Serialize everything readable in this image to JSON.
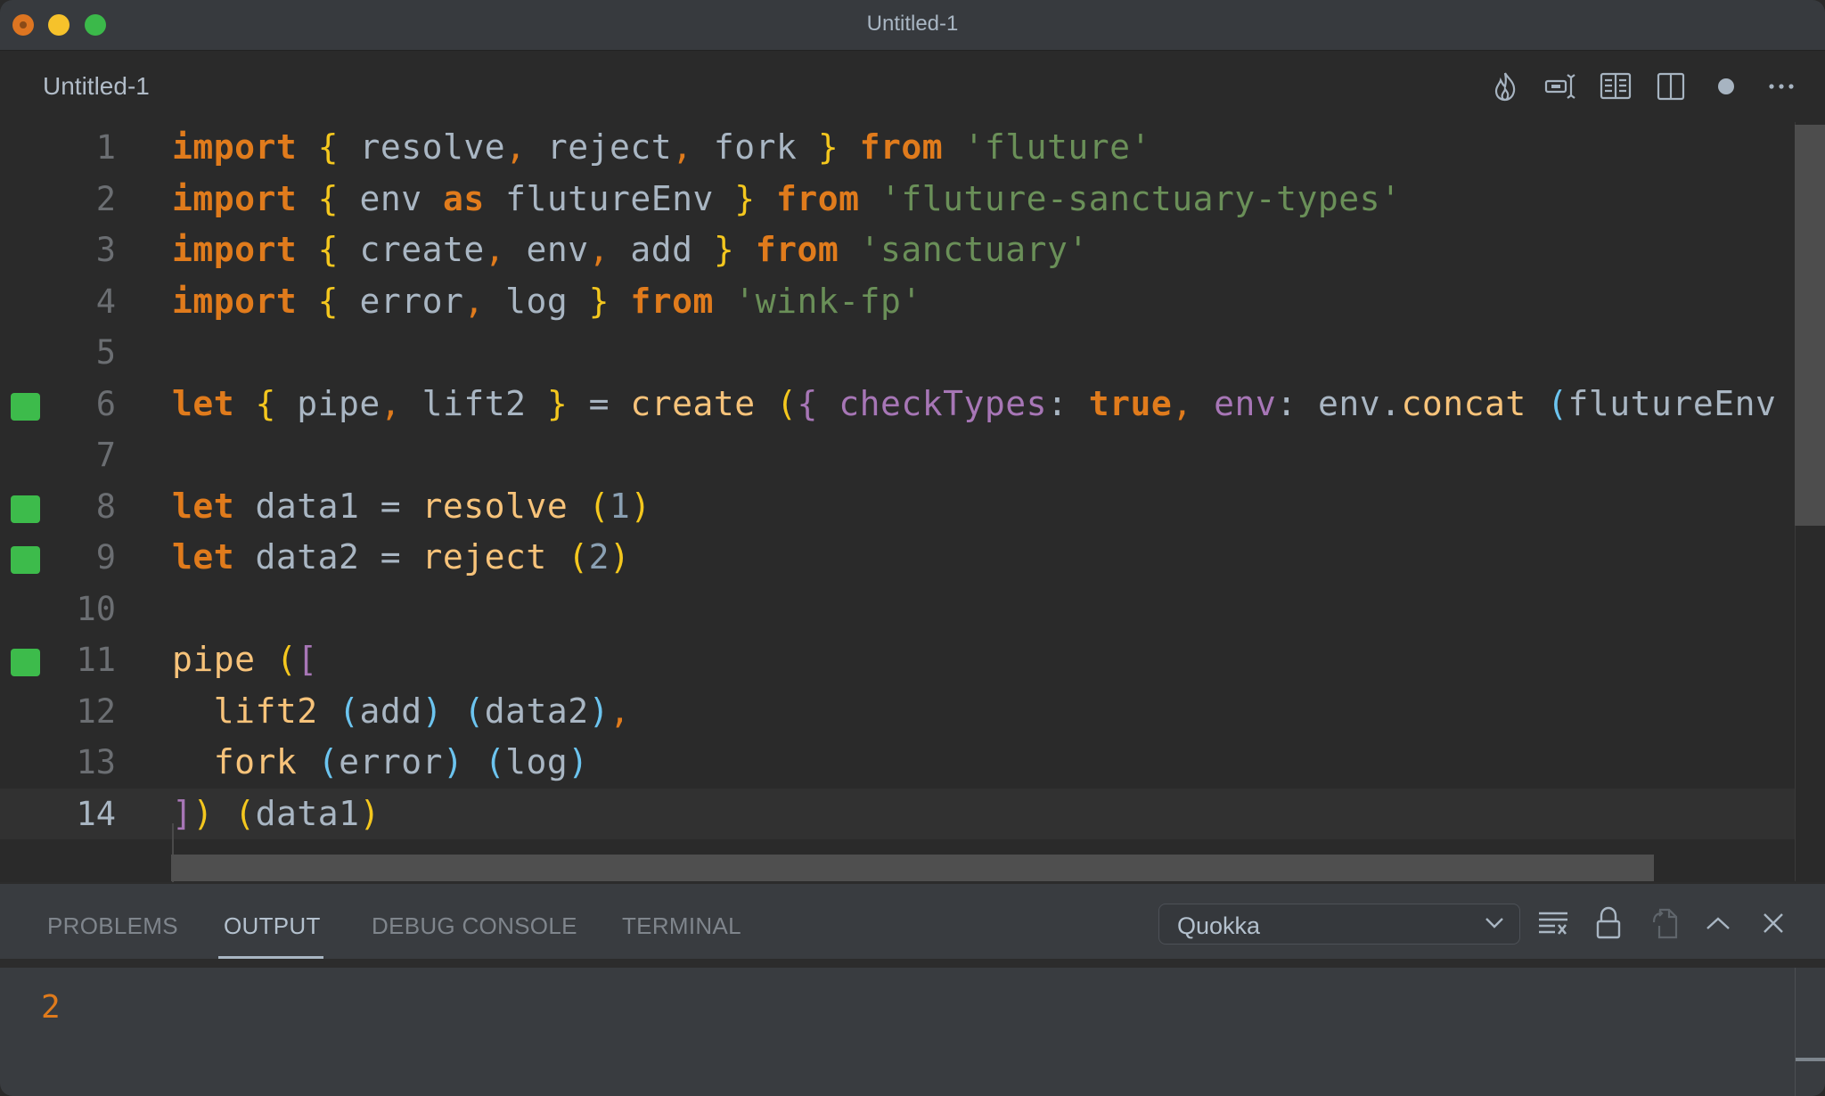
{
  "window": {
    "title": "Untitled-1"
  },
  "tab": {
    "label": "Untitled-1",
    "actions": [
      {
        "name": "quokka-flame-icon"
      },
      {
        "name": "toggle-value-icon"
      },
      {
        "name": "open-preview-icon"
      },
      {
        "name": "split-editor-icon"
      },
      {
        "name": "unsaved-dot-icon"
      },
      {
        "name": "more-actions-icon"
      }
    ]
  },
  "editor": {
    "current_line": 14,
    "lines": [
      {
        "number": "1",
        "marker": false
      },
      {
        "number": "2",
        "marker": false
      },
      {
        "number": "3",
        "marker": false
      },
      {
        "number": "4",
        "marker": false
      },
      {
        "number": "5",
        "marker": false
      },
      {
        "number": "6",
        "marker": true
      },
      {
        "number": "7",
        "marker": false
      },
      {
        "number": "8",
        "marker": true
      },
      {
        "number": "9",
        "marker": true
      },
      {
        "number": "10",
        "marker": false
      },
      {
        "number": "11",
        "marker": true
      },
      {
        "number": "12",
        "marker": false
      },
      {
        "number": "13",
        "marker": false
      },
      {
        "number": "14",
        "marker": false
      }
    ],
    "code": [
      [
        [
          "kw",
          "import"
        ],
        [
          "op",
          " "
        ],
        [
          "brace",
          "{"
        ],
        [
          "op",
          " resolve"
        ],
        [
          "punc",
          ","
        ],
        [
          "op",
          " reject"
        ],
        [
          "punc",
          ","
        ],
        [
          "op",
          " fork "
        ],
        [
          "brace",
          "}"
        ],
        [
          "op",
          " "
        ],
        [
          "kw",
          "from"
        ],
        [
          "op",
          " "
        ],
        [
          "str",
          "'fluture'"
        ]
      ],
      [
        [
          "kw",
          "import"
        ],
        [
          "op",
          " "
        ],
        [
          "brace",
          "{"
        ],
        [
          "op",
          " env "
        ],
        [
          "kw",
          "as"
        ],
        [
          "op",
          " flutureEnv "
        ],
        [
          "brace",
          "}"
        ],
        [
          "op",
          " "
        ],
        [
          "kw",
          "from"
        ],
        [
          "op",
          " "
        ],
        [
          "str",
          "'fluture-sanctuary-types'"
        ]
      ],
      [
        [
          "kw",
          "import"
        ],
        [
          "op",
          " "
        ],
        [
          "brace",
          "{"
        ],
        [
          "op",
          " create"
        ],
        [
          "punc",
          ","
        ],
        [
          "op",
          " env"
        ],
        [
          "punc",
          ","
        ],
        [
          "op",
          " add "
        ],
        [
          "brace",
          "}"
        ],
        [
          "op",
          " "
        ],
        [
          "kw",
          "from"
        ],
        [
          "op",
          " "
        ],
        [
          "str",
          "'sanctuary'"
        ]
      ],
      [
        [
          "kw",
          "import"
        ],
        [
          "op",
          " "
        ],
        [
          "brace",
          "{"
        ],
        [
          "op",
          " error"
        ],
        [
          "punc",
          ","
        ],
        [
          "op",
          " log "
        ],
        [
          "brace",
          "}"
        ],
        [
          "op",
          " "
        ],
        [
          "kw",
          "from"
        ],
        [
          "op",
          " "
        ],
        [
          "str",
          "'wink-fp'"
        ]
      ],
      [],
      [
        [
          "kw",
          "let"
        ],
        [
          "op",
          " "
        ],
        [
          "brace",
          "{"
        ],
        [
          "op",
          " pipe"
        ],
        [
          "punc",
          ","
        ],
        [
          "op",
          " lift2 "
        ],
        [
          "brace",
          "}"
        ],
        [
          "op",
          " = "
        ],
        [
          "fn",
          "create"
        ],
        [
          "op",
          " "
        ],
        [
          "brace",
          "("
        ],
        [
          "purple",
          "{"
        ],
        [
          "prop",
          " checkTypes"
        ],
        [
          "op",
          ": "
        ],
        [
          "bool",
          "true"
        ],
        [
          "punc",
          ","
        ],
        [
          "prop",
          " env"
        ],
        [
          "op",
          ": env."
        ],
        [
          "fn",
          "concat"
        ],
        [
          "op",
          " "
        ],
        [
          "blue",
          "("
        ],
        [
          "op",
          "flutureEnv"
        ]
      ],
      [],
      [
        [
          "kw",
          "let"
        ],
        [
          "op",
          " data1 = "
        ],
        [
          "fn",
          "resolve"
        ],
        [
          "op",
          " "
        ],
        [
          "brace",
          "("
        ],
        [
          "num",
          "1"
        ],
        [
          "brace",
          ")"
        ]
      ],
      [
        [
          "kw",
          "let"
        ],
        [
          "op",
          " data2 = "
        ],
        [
          "fn",
          "reject"
        ],
        [
          "op",
          " "
        ],
        [
          "brace",
          "("
        ],
        [
          "num",
          "2"
        ],
        [
          "brace",
          ")"
        ]
      ],
      [],
      [
        [
          "fn",
          "pipe"
        ],
        [
          "op",
          " "
        ],
        [
          "brace",
          "("
        ],
        [
          "purple",
          "["
        ]
      ],
      [
        [
          "op",
          "  "
        ],
        [
          "fn",
          "lift2"
        ],
        [
          "op",
          " "
        ],
        [
          "blue",
          "("
        ],
        [
          "op",
          "add"
        ],
        [
          "blue",
          ")"
        ],
        [
          "op",
          " "
        ],
        [
          "blue",
          "("
        ],
        [
          "op",
          "data2"
        ],
        [
          "blue",
          ")"
        ],
        [
          "punc",
          ","
        ]
      ],
      [
        [
          "op",
          "  "
        ],
        [
          "fn",
          "fork"
        ],
        [
          "op",
          " "
        ],
        [
          "blue",
          "("
        ],
        [
          "op",
          "error"
        ],
        [
          "blue",
          ")"
        ],
        [
          "op",
          " "
        ],
        [
          "blue",
          "("
        ],
        [
          "op",
          "log"
        ],
        [
          "blue",
          ")"
        ]
      ],
      [
        [
          "purple",
          "]"
        ],
        [
          "brace",
          ")"
        ],
        [
          "op",
          " "
        ],
        [
          "brace",
          "("
        ],
        [
          "op",
          "data1"
        ],
        [
          "brace",
          ")"
        ]
      ]
    ]
  },
  "panel": {
    "tabs": [
      {
        "label": "PROBLEMS",
        "active": false
      },
      {
        "label": "OUTPUT",
        "active": true
      },
      {
        "label": "DEBUG CONSOLE",
        "active": false
      },
      {
        "label": "TERMINAL",
        "active": false
      }
    ],
    "channel_select": {
      "value": "Quokka"
    },
    "output_lines": [
      "2"
    ]
  },
  "colors": {
    "keyword": "#e07b1c",
    "brace": "#f4c71e",
    "string": "#6a8f58",
    "function": "#f7c37a",
    "property": "#a776b6",
    "gutter_marker": "#3dbb4b"
  }
}
